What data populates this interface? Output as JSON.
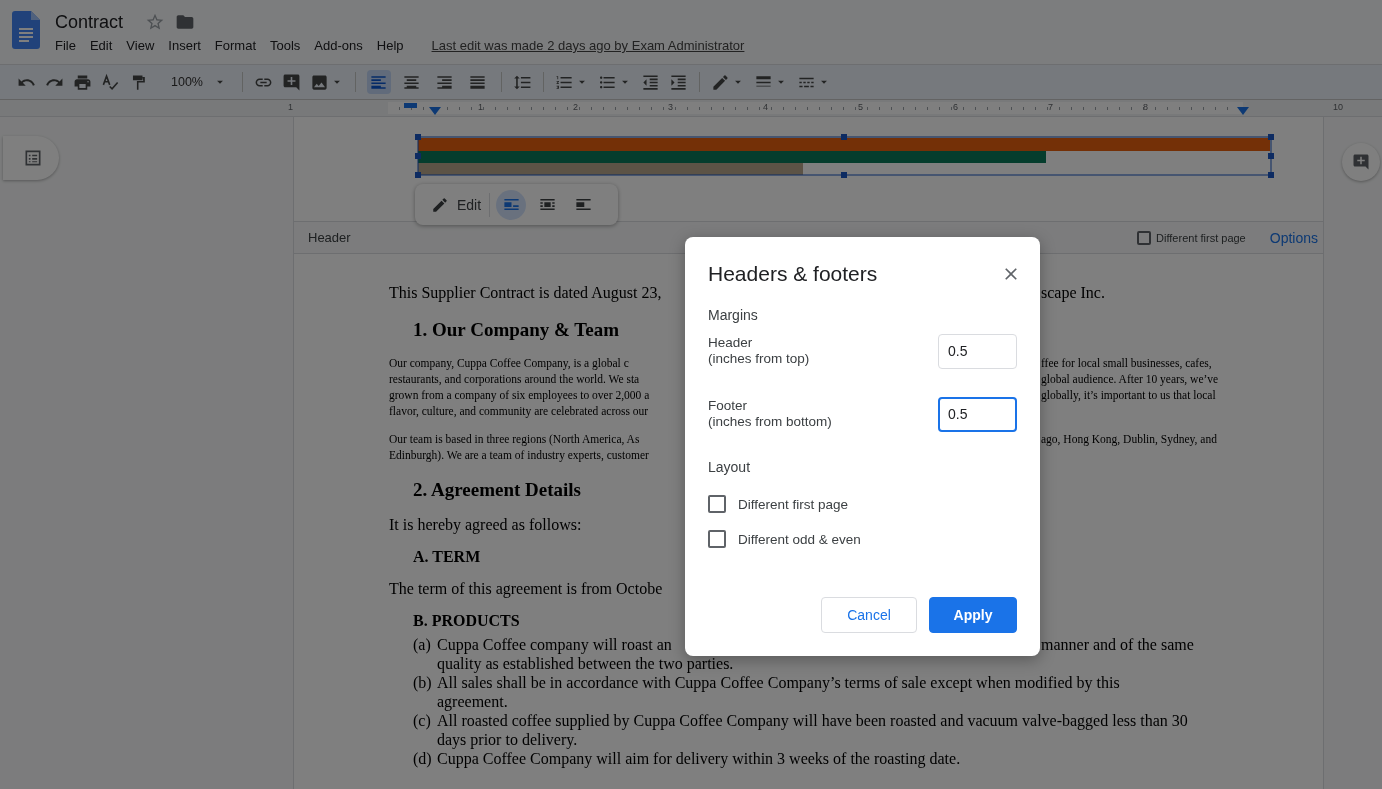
{
  "document": {
    "title": "Contract",
    "last_edit": "Last edit was made 2 days ago by Exam Administrator"
  },
  "menu": [
    "File",
    "Edit",
    "View",
    "Insert",
    "Format",
    "Tools",
    "Add-ons",
    "Help"
  ],
  "toolbar": {
    "zoom": "100%",
    "alignment": [
      {
        "selected": true
      },
      {
        "selected": false
      },
      {
        "selected": false
      },
      {
        "selected": false
      }
    ]
  },
  "ruler": {
    "labels": [
      "1",
      "1",
      "2",
      "3",
      "4",
      "5",
      "6",
      "7",
      "8",
      "10"
    ]
  },
  "image_toolbar": {
    "edit": "Edit",
    "wrap_options": [
      {
        "selected": true
      },
      {
        "selected": false
      },
      {
        "selected": false
      }
    ]
  },
  "header_bar": {
    "label": "Header",
    "different_first_page": {
      "label": "Different first page",
      "checked": false
    },
    "options": "Options"
  },
  "body": [
    {
      "kind": "para",
      "lines": [
        {
          "left": "This Supplier Contract is dated August 23,",
          "right": "scape Inc."
        }
      ]
    },
    {
      "kind": "heading",
      "lines": [
        {
          "left": "1. Our Company & Team"
        }
      ]
    },
    {
      "kind": "small",
      "lines": [
        {
          "left": "Our company, Cuppa Coffee Company, is a global c",
          "right": "ffee for local small businesses, cafes,"
        },
        {
          "left": "restaurants, and corporations around the world. We sta",
          "right": "global audience. After 10 years, we’ve"
        },
        {
          "left": "grown from a company of six employees to over 2,000 a",
          "right": "globally, it’s important to us that local"
        },
        {
          "left": "flavor, culture, and community are celebrated across our"
        }
      ]
    },
    {
      "kind": "small",
      "lines": [
        {
          "left": "Our team is based in three regions (North America, As",
          "right": "ago, Hong Kong, Dublin, Sydney, and"
        },
        {
          "left": "Edinburgh). We are a team of industry experts, customer"
        }
      ]
    },
    {
      "kind": "heading",
      "lines": [
        {
          "left": "2. Agreement Details"
        }
      ]
    },
    {
      "kind": "para",
      "lines": [
        {
          "left": "It is hereby agreed as follows:"
        }
      ]
    },
    {
      "kind": "subheading",
      "lines": [
        {
          "left": "A. TERM"
        }
      ]
    },
    {
      "kind": "para",
      "lines": [
        {
          "left": "The term of this agreement is from Octobe"
        }
      ]
    },
    {
      "kind": "subheading",
      "lines": [
        {
          "left": "B. PRODUCTS"
        }
      ]
    },
    {
      "kind": "list",
      "items": [
        {
          "marker": "(a)",
          "lines": [
            {
              "left": "Cuppa Coffee company will roast an",
              "right": "manner and of the same"
            },
            {
              "left": "quality as established between the two parties."
            }
          ]
        },
        {
          "marker": "(b)",
          "lines": [
            {
              "left": "All sales shall be in accordance with Cuppa Coffee Company’s terms of sale except when modified by this"
            },
            {
              "left": "agreement."
            }
          ]
        },
        {
          "marker": "(c)",
          "lines": [
            {
              "left": "All roasted coffee supplied by Cuppa Coffee Company will have been roasted and vacuum valve-bagged less than 30"
            },
            {
              "left": "days prior to delivery."
            }
          ]
        },
        {
          "marker": "(d)",
          "lines": [
            {
              "left": "Cuppa Coffee Company will aim for delivery within 3 weeks of the roasting date."
            }
          ]
        }
      ]
    }
  ],
  "dialog": {
    "title": "Headers & footers",
    "margins_heading": "Margins",
    "fields": [
      {
        "label": "Header",
        "sublabel": "(inches from top)",
        "value": "0.5",
        "focused": false
      },
      {
        "label": "Footer",
        "sublabel": "(inches from bottom)",
        "value": "0.5",
        "focused": true
      }
    ],
    "layout_heading": "Layout",
    "checkboxes": [
      {
        "label": "Different first page",
        "checked": false
      },
      {
        "label": "Different odd & even",
        "checked": false
      }
    ],
    "buttons": [
      {
        "label": "Cancel",
        "kind": "secondary"
      },
      {
        "label": "Apply",
        "kind": "primary"
      }
    ]
  }
}
